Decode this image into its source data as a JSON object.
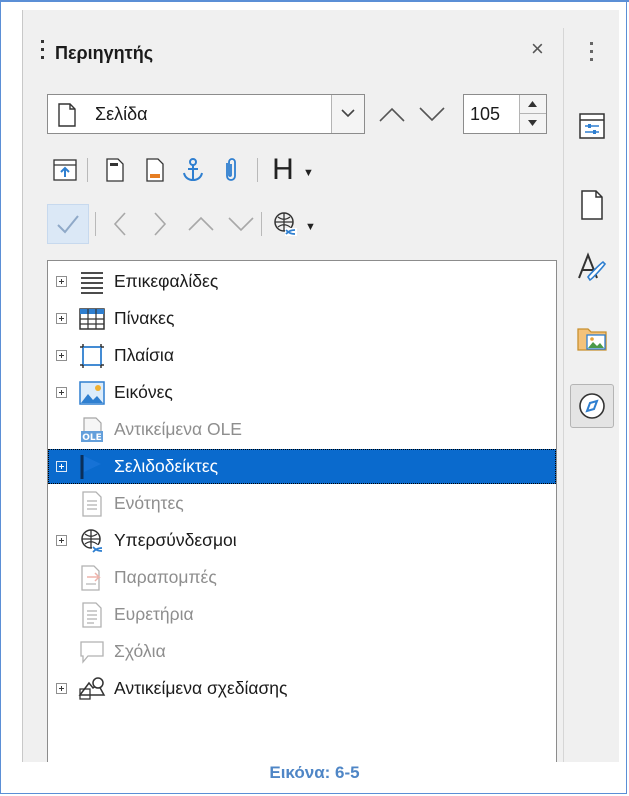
{
  "navigator": {
    "title": "Περιηγητής",
    "close_label": "×",
    "navigate_by": {
      "value": "Σελίδα",
      "icon": "page-icon"
    },
    "page_number": "105",
    "tree": [
      {
        "label": "Επικεφαλίδες",
        "icon": "headings-icon",
        "expandable": true,
        "dimmed": false,
        "selected": false
      },
      {
        "label": "Πίνακες",
        "icon": "table-icon",
        "expandable": true,
        "dimmed": false,
        "selected": false
      },
      {
        "label": "Πλαίσια",
        "icon": "frame-icon",
        "expandable": true,
        "dimmed": false,
        "selected": false
      },
      {
        "label": "Εικόνες",
        "icon": "image-icon",
        "expandable": true,
        "dimmed": false,
        "selected": false
      },
      {
        "label": "Αντικείμενα OLE",
        "icon": "ole-icon",
        "expandable": false,
        "dimmed": true,
        "selected": false
      },
      {
        "label": "Σελιδοδείκτες",
        "icon": "bookmark-icon",
        "expandable": true,
        "dimmed": false,
        "selected": true
      },
      {
        "label": "Ενότητες",
        "icon": "section-icon",
        "expandable": false,
        "dimmed": true,
        "selected": false
      },
      {
        "label": "Υπερσύνδεσμοι",
        "icon": "hyperlink-icon",
        "expandable": true,
        "dimmed": false,
        "selected": false
      },
      {
        "label": "Παραπομπές",
        "icon": "reference-icon",
        "expandable": false,
        "dimmed": true,
        "selected": false
      },
      {
        "label": "Ευρετήρια",
        "icon": "index-icon",
        "expandable": false,
        "dimmed": true,
        "selected": false
      },
      {
        "label": "Σχόλια",
        "icon": "comment-icon",
        "expandable": false,
        "dimmed": true,
        "selected": false
      },
      {
        "label": "Αντικείμενα σχεδίασης",
        "icon": "drawing-object-icon",
        "expandable": true,
        "dimmed": false,
        "selected": false
      }
    ]
  },
  "toolbar": {
    "heading_level_label": "H"
  },
  "caption": "Εικόνα: 6-5",
  "colors": {
    "accent": "#0a6acd",
    "frame_border": "#5b8fd6",
    "caption": "#4f86c6",
    "icon_blue": "#2f7fd0"
  }
}
